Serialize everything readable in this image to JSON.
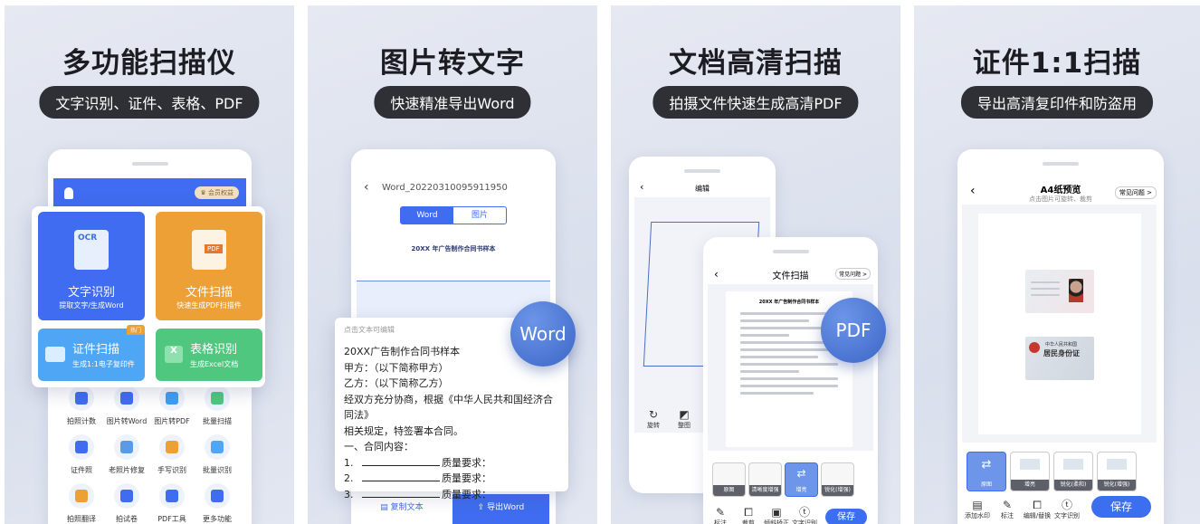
{
  "panels": [
    {
      "title": "多功能扫描仪",
      "subtitle": "文字识别、证件、表格、PDF",
      "member_badge": "会员权益",
      "tiles": [
        {
          "title": "文字识别",
          "desc": "提取文字/生成Word",
          "icon_text": "OCR",
          "color": "#3f6cf0"
        },
        {
          "title": "文件扫描",
          "desc": "快速生成PDF扫描件",
          "icon_text": "PDF",
          "color": "#eca035"
        },
        {
          "title": "证件扫描",
          "desc": "生成1:1电子复印件",
          "badge": "热门",
          "color": "#4ea6f4"
        },
        {
          "title": "表格识别",
          "desc": "生成Excel文档",
          "icon_text": "X",
          "color": "#4fc77f"
        }
      ],
      "grid": [
        "拍照计数",
        "图片转Word",
        "图片转PDF",
        "批量扫描",
        "证件照",
        "老照片修复",
        "手写识别",
        "批量识别",
        "拍照翻译",
        "拍试卷",
        "PDF工具",
        "更多功能"
      ]
    },
    {
      "title": "图片转文字",
      "subtitle": "快速精准导出Word",
      "file_name": "Word_20220310095911950",
      "tabs": [
        "Word",
        "图片"
      ],
      "doc_title": "20XX 年广告制作合同书样本",
      "hint": "点击文本可编辑",
      "lines": [
        "20XX广告制作合同书样本",
        "甲方：（以下简称甲方）",
        "乙方：（以下简称乙方）",
        "经双方充分协商，根据《中华人民共和国经济合同法》",
        "相关规定，特签署本合同。",
        "一、合同内容："
      ],
      "items": [
        {
          "num": "1.",
          "label": "质量要求："
        },
        {
          "num": "2.",
          "label": "质量要求："
        },
        {
          "num": "3.",
          "label": "质量要求："
        }
      ],
      "badge": "Word",
      "copy_btn": "复制文本",
      "export_btn": "导出Word"
    },
    {
      "title": "文档高清扫描",
      "subtitle": "拍摄文件快速生成高清PDF",
      "back_title": "编辑",
      "back_tools": [
        "旋转",
        "整图"
      ],
      "front_title": "文件扫描",
      "faq": "常见问题 >",
      "doc_title": "20XX 年广告制作合同书样本",
      "badge": "PDF",
      "filters": [
        "原图",
        "清晰度增强",
        "增亮",
        "锐化(增强)"
      ],
      "tools": [
        "标注",
        "裁剪",
        "倾斜矫正",
        "文字识别"
      ],
      "save": "保存"
    },
    {
      "title": "证件1:1扫描",
      "subtitle": "导出高清复印件和防盗用",
      "page_title": "A4纸预览",
      "page_sub": "点击图片可旋转、裁剪",
      "faq": "常见问题 >",
      "id_back_line1": "中华人民共和国",
      "id_back_line2": "居民身份证",
      "filters": [
        "原图",
        "增亮",
        "锐化(柔和)",
        "锐化(增强)"
      ],
      "tools": [
        "添加水印",
        "标注",
        "编辑/替换",
        "文字识别"
      ],
      "save": "保存"
    }
  ],
  "colors": {
    "accent": "#3c6ef0",
    "pill": "#2e3036"
  }
}
